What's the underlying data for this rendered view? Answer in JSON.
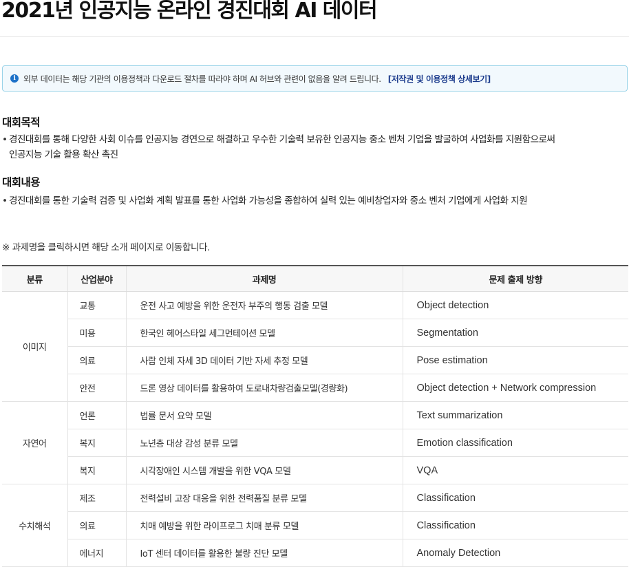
{
  "page_title": "2021년 인공지능 온라인 경진대회 AI 데이터",
  "notice": {
    "icon": "info-icon",
    "text": "외부 데이터는 해당 기관의 이용정책과 다운로드 절차를 따라야 하며 AI 허브와 관련이 없음을 알려 드립니다.",
    "link_label": "[저작권 및 이용정책 상세보기]"
  },
  "purpose": {
    "heading": "대회목적",
    "line1": "경진대회를 통해 다양한 사회 이슈를 인공지능 경연으로 해결하고 우수한 기술력 보유한 인공지능 중소 벤처 기업을 발굴하여 사업화를 지원함으로써",
    "line2": "인공지능 기술 활용 확산 촉진"
  },
  "content": {
    "heading": "대회내용",
    "text": "경진대회를 통한 기술력 검증 및 사업화 계획 발표를 통한 사업화 가능성을 종합하여 실력 있는 예비창업자와 중소 벤처 기업에게 사업화 지원"
  },
  "table_note": "※ 과제명을 클릭하시면 해당 소개 페이지로 이동합니다.",
  "table": {
    "headers": [
      "분류",
      "산업분야",
      "과제명",
      "문제 출제 방향"
    ],
    "rows": [
      {
        "category": "이미지",
        "industry": "교통",
        "task": "운전 사고 예방을 위한 운전자 부주의 행동 검출 모델",
        "direction": "Object detection"
      },
      {
        "category": "",
        "industry": "미용",
        "task": "한국인 헤어스타일 세그먼테이션 모델",
        "direction": "Segmentation"
      },
      {
        "category": "",
        "industry": "의료",
        "task": "사람 인체 자세 3D 데이터 기반 자세 추정 모델",
        "direction": "Pose estimation"
      },
      {
        "category": "",
        "industry": "안전",
        "task": "드론 영상 데이터를 활용하여 도로내차량검출모델(경량화)",
        "direction": "Object detection + Network compression"
      },
      {
        "category": "자연어",
        "industry": "언론",
        "task": "법률 문서 요약 모델",
        "direction": "Text summarization"
      },
      {
        "category": "",
        "industry": "복지",
        "task": "노년층 대상 감성 분류 모델",
        "direction": "Emotion classification"
      },
      {
        "category": "",
        "industry": "복지",
        "task": "시각장애인 시스템 개발을 위한 VQA 모델",
        "direction": "VQA"
      },
      {
        "category": "수치해석",
        "industry": "제조",
        "task": "전력설비 고장 대응을 위한 전력품질 분류 모델",
        "direction": "Classification"
      },
      {
        "category": "",
        "industry": "의료",
        "task": "치매 예방을 위한 라이프로그 치매 분류 모델",
        "direction": "Classification"
      },
      {
        "category": "",
        "industry": "에너지",
        "task": "IoT 센터 데이터를 활용한 불량 진단 모델",
        "direction": "Anomaly Detection"
      }
    ]
  }
}
